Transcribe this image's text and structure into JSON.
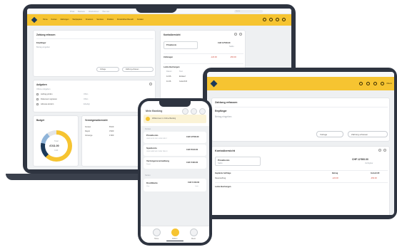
{
  "colors": {
    "brand_yellow": "#f6c431",
    "brand_navy": "#1c3a5a",
    "device_frame": "#2e3440",
    "alert_red": "#d0483a"
  },
  "icons": [
    "diamond-logo-icon",
    "bell-icon",
    "mail-icon",
    "user-icon",
    "settings-icon",
    "more-icon",
    "home-icon",
    "account-icon",
    "menu-icon"
  ],
  "laptop": {
    "top_links": [
      "Privat",
      "Business",
      "Unternehmen",
      "Über uns"
    ],
    "search_placeholder": "Suche",
    "nav_items": [
      "Home",
      "Konten",
      "Zahlungen",
      "Wertpapiere",
      "Finanzen",
      "Services",
      "Postbox",
      "Persönlicher Bereich",
      "Kontakt"
    ],
    "payment_card": {
      "title": "Zahlung erfassen",
      "field_label": "Empfänger",
      "field_value": "Betrag eingeben",
      "btn_template": "Vorlage",
      "btn_submit": "Zahlung erfassen"
    },
    "overview_card": {
      "title": "Kontoübersicht",
      "select_label": "Privatkonto",
      "balance": "CHF 12'500.00",
      "balance_caption": "Saldo",
      "payments_label": "Zahlungen",
      "payment_amount_1": "-120.00",
      "payment_amount_2": "-450.00",
      "transactions_label": "Letzte Buchungen",
      "transactions_cols": [
        "Datum",
        "Text",
        "Betrag"
      ],
      "transactions": [
        {
          "date": "12.06.",
          "text": "Einkauf",
          "amount": "-48.20"
        },
        {
          "date": "11.06.",
          "text": "Gutschrift",
          "amount": "2'400.00"
        }
      ]
    },
    "list_card": {
      "title": "Aufgaben",
      "header": "Offene Aufgaben",
      "rows": [
        {
          "name": "Auftrag prüfen",
          "status": "Offen"
        },
        {
          "name": "Dokument signieren",
          "status": "Offen"
        },
        {
          "name": "Adresse ändern",
          "status": "Erledigt"
        }
      ]
    },
    "budget_card": {
      "title": "Budget",
      "center_value": "4'211.00",
      "center_caption": "Total",
      "center_label": "CHF"
    },
    "small_card": {
      "title": "Vermögensübersicht",
      "rows": [
        [
          "Konten",
          "8'100"
        ],
        [
          "Depot",
          "3'400"
        ],
        [
          "Vorsorge",
          "1'000"
        ]
      ]
    }
  },
  "tablet": {
    "nav_label": "Menü",
    "payment_card": {
      "title": "Zahlung erfassen",
      "field_label": "Empfänger",
      "field_value": "Betrag eingeben",
      "btn_template": "Vorlage",
      "btn_submit": "Zahlung erfassen"
    },
    "overview_card": {
      "title": "Kontoübersicht",
      "select_label": "Privatkonto",
      "select_sub": "Saldo",
      "balance": "CHF 12'500.00",
      "balance_caption": "Verfügbar",
      "cols": [
        "Geplante Aufträge",
        "Betrag",
        "Gutschrift"
      ],
      "row": [
        "Dauerauftrag",
        "-120.00",
        "-450.00"
      ],
      "transactions_label": "Letzte Buchungen"
    }
  },
  "phone": {
    "title": "Mein Banking",
    "banner_text": "Willkommen im Online Banking",
    "section_accounts": "Konten",
    "accounts": [
      {
        "name": "Privatkonto",
        "iban": "CH93 0076 2011 6238 5295 7",
        "amount": "CHF 12'500.00"
      },
      {
        "name": "Sparkonto",
        "iban": "CH56 0483 5012 3456 7800 9",
        "amount": "CHF 8'100.00"
      },
      {
        "name": "Vermögensverwaltung",
        "iban": "Depot",
        "amount": "CHF 3'400.00"
      }
    ],
    "section_cards": "Karten",
    "card": {
      "name": "Kreditkarte",
      "sub": "Visa",
      "amount": "CHF 1'240.00",
      "sub_amount": "Limit"
    },
    "tabs": [
      "Home",
      "Zahlen",
      "Menü"
    ]
  }
}
